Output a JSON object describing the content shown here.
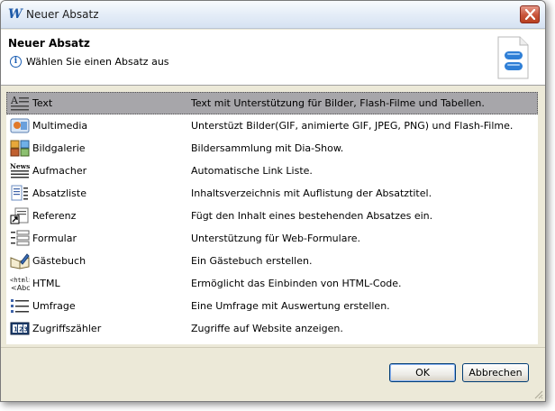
{
  "window": {
    "title": "Neuer Absatz"
  },
  "header": {
    "title": "Neuer Absatz",
    "subtitle": "Wählen Sie einen Absatz aus"
  },
  "items": [
    {
      "icon": "text-icon",
      "label": "Text",
      "description": "Text mit Unterstützung für Bilder, Flash-Filme und Tabellen.",
      "selected": true
    },
    {
      "icon": "multimedia-icon",
      "label": "Multimedia",
      "description": "Unterstüzt Bilder(GIF, animierte GIF, JPEG, PNG) und Flash-Filme.",
      "selected": false
    },
    {
      "icon": "gallery-icon",
      "label": "Bildgalerie",
      "description": "Bildersammlung mit Dia-Show.",
      "selected": false
    },
    {
      "icon": "news-icon",
      "label": "Aufmacher",
      "description": "Automatische Link Liste.",
      "selected": false
    },
    {
      "icon": "list-icon",
      "label": "Absatzliste",
      "description": "Inhaltsverzeichnis mit Auflistung der Absatztitel.",
      "selected": false
    },
    {
      "icon": "reference-icon",
      "label": "Referenz",
      "description": "Fügt den Inhalt eines bestehenden Absatzes ein.",
      "selected": false
    },
    {
      "icon": "form-icon",
      "label": "Formular",
      "description": "Unterstützung für Web-Formulare.",
      "selected": false
    },
    {
      "icon": "guestbook-icon",
      "label": "Gästebuch",
      "description": "Ein Gästebuch erstellen.",
      "selected": false
    },
    {
      "icon": "html-icon",
      "label": "HTML",
      "description": "Ermöglicht das Einbinden von HTML-Code.",
      "selected": false
    },
    {
      "icon": "survey-icon",
      "label": "Umfrage",
      "description": "Eine Umfrage mit Auswertung erstellen.",
      "selected": false
    },
    {
      "icon": "counter-icon",
      "label": "Zugriffszähler",
      "description": "Zugriffe auf Website anzeigen.",
      "selected": false
    }
  ],
  "buttons": {
    "ok": "OK",
    "cancel": "Abbrechen"
  },
  "colors": {
    "selection": "#a7a6aa",
    "dialog_bg": "#ece9d8",
    "close_button": "#c8533a"
  }
}
